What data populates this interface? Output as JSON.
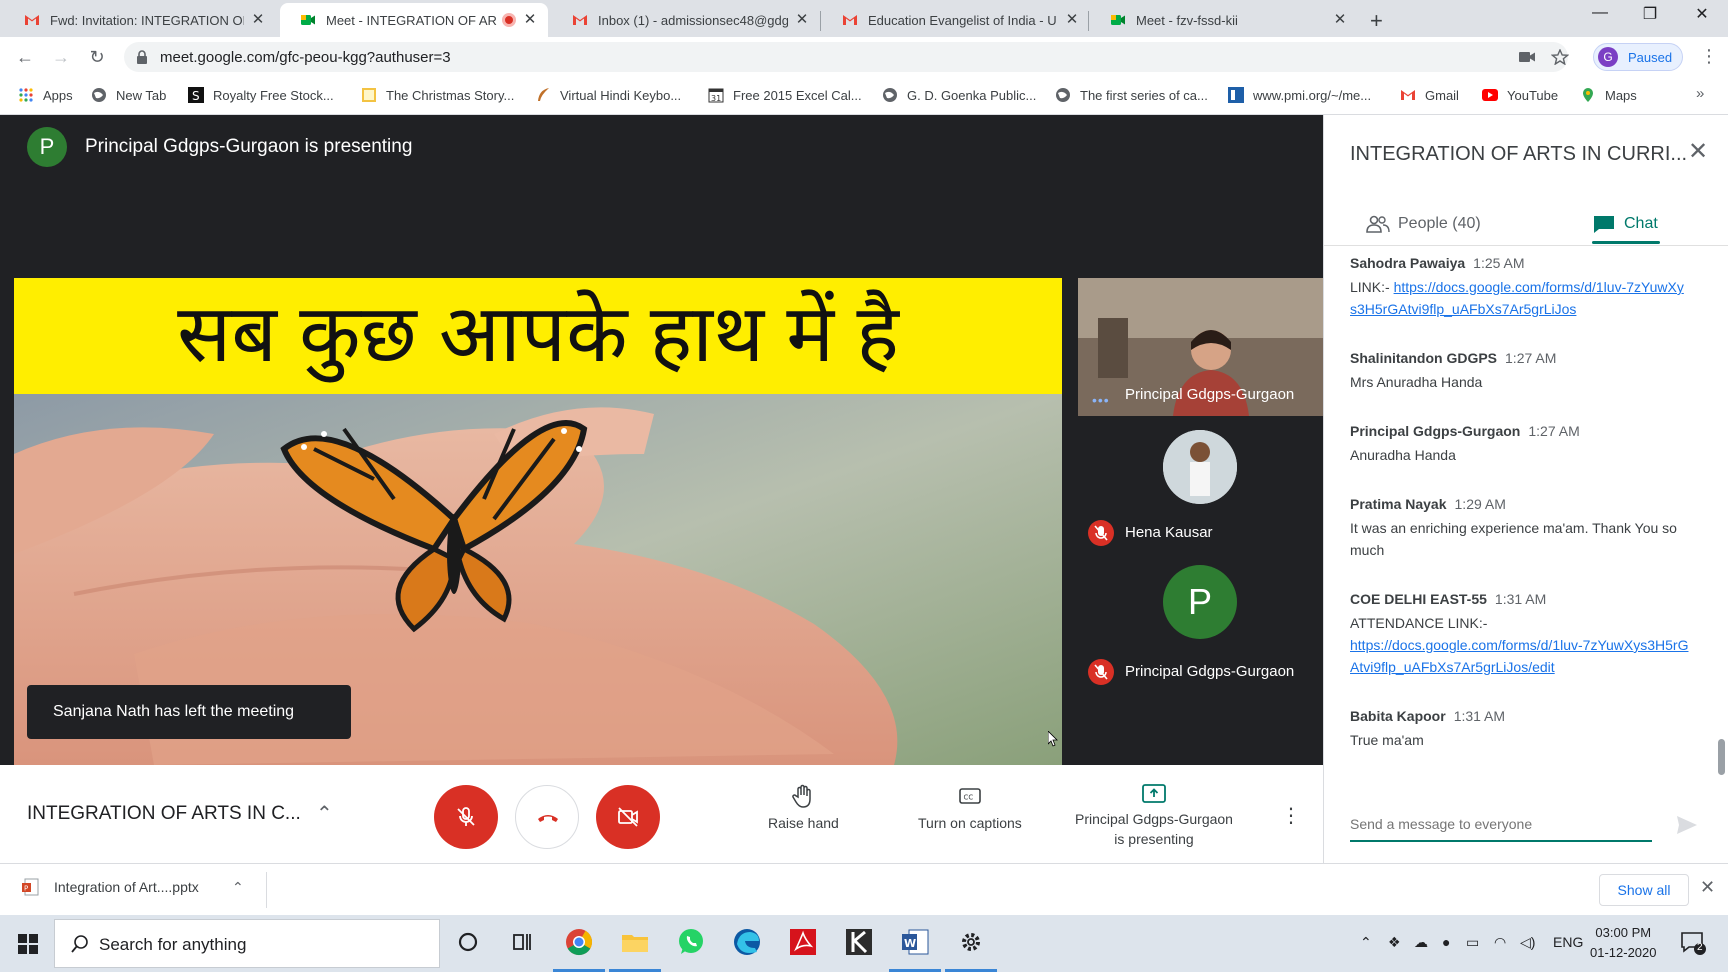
{
  "browser": {
    "tabs": [
      {
        "title": "Fwd: Invitation: INTEGRATION OF",
        "icon": "gmail-icon"
      },
      {
        "title": "Meet - INTEGRATION OF AR",
        "icon": "meet-icon",
        "active": true
      },
      {
        "title": "Inbox (1) - admissionsec48@gdg",
        "icon": "gmail-icon"
      },
      {
        "title": "Education Evangelist of India - U",
        "icon": "gmail-icon"
      },
      {
        "title": "Meet - fzv-fssd-kii",
        "icon": "meet-icon"
      }
    ],
    "url": "meet.google.com/gfc-peou-kgg?authuser=3",
    "profile_initial": "G",
    "profile_label": "Paused",
    "bookmarks": [
      "Apps",
      "New Tab",
      "Royalty Free Stock...",
      "The Christmas Story...",
      "Virtual Hindi Keybo...",
      "Free 2015 Excel Cal...",
      "G. D. Goenka Public...",
      "The first series of ca...",
      "www.pmi.org/~/me...",
      "Gmail",
      "YouTube",
      "Maps"
    ]
  },
  "meet": {
    "presenter_initial": "P",
    "presenter_banner": "Principal Gdgps-Gurgaon is presenting",
    "slide_heading": "सब कुछ आपके हाथ में है",
    "toast": "Sanjana Nath has left the meeting",
    "participants": [
      {
        "name": "Principal Gdgps-Gurgaon"
      },
      {
        "name": "Hena Kausar"
      },
      {
        "name": "Principal Gdgps-Gurgaon",
        "initial": "P"
      }
    ],
    "meeting_title": "INTEGRATION OF ARTS IN C...",
    "actions": {
      "raise_hand": "Raise hand",
      "captions": "Turn on captions",
      "presenting_line1": "Principal Gdgps-Gurgaon",
      "presenting_line2": "is presenting"
    }
  },
  "panel": {
    "title": "INTEGRATION OF ARTS IN CURRI...",
    "people_tab": "People (40)",
    "chat_tab": "Chat",
    "messages": [
      {
        "sender": "Sahodra Pawaiya",
        "time": "1:25 AM",
        "prefix": "LINK:- ",
        "link": "https://docs.google.com/forms/d/1luv-7zYuwXys3H5rGAtvi9flp_uAFbXs7Ar5grLiJos"
      },
      {
        "sender": "Shalinitandon GDGPS",
        "time": "1:27 AM",
        "text": "Mrs Anuradha Handa"
      },
      {
        "sender": "Principal Gdgps-Gurgaon",
        "time": "1:27 AM",
        "text": "Anuradha Handa"
      },
      {
        "sender": "Pratima Nayak",
        "time": "1:29 AM",
        "text": "It was an enriching experience ma'am.  Thank You so much"
      },
      {
        "sender": "COE DELHI EAST-55",
        "time": "1:31 AM",
        "text": "ATTENDANCE LINK:-",
        "link": "https://docs.google.com/forms/d/1luv-7zYuwXys3H5rGAtvi9flp_uAFbXs7Ar5grLiJos/edit"
      },
      {
        "sender": "Babita Kapoor",
        "time": "1:31 AM",
        "text": "True ma'am"
      }
    ],
    "compose_placeholder": "Send a message to everyone"
  },
  "downloads": {
    "file": "Integration of Art....pptx",
    "show_all": "Show all"
  },
  "taskbar": {
    "search_placeholder": "Search for anything",
    "lang": "ENG",
    "time": "03:00 PM",
    "date": "01-12-2020",
    "notification_count": "2"
  },
  "colors": {
    "meet_bg": "#202124",
    "danger_red": "#d93025",
    "chat_accent": "#00796b",
    "link_blue": "#1a73e8",
    "slide_yellow": "#ffee00"
  }
}
